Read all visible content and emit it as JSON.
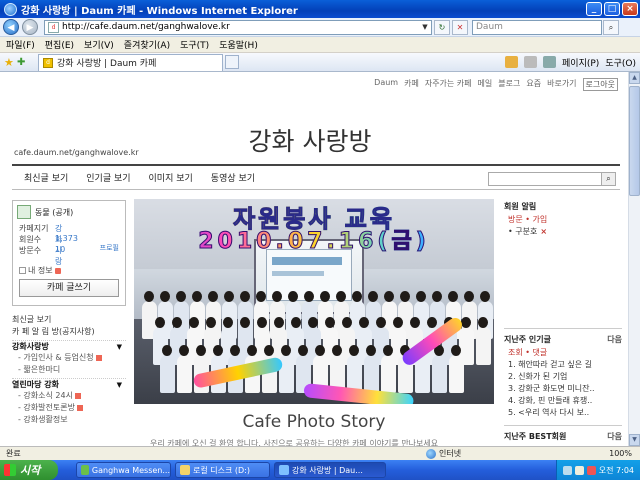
{
  "window": {
    "title": "강화 사랑방 | Daum 카페 - Windows Internet Explorer"
  },
  "address": {
    "url": "http://cafe.daum.net/ganghwalove.kr",
    "search_placeholder": "Daum"
  },
  "menu": {
    "items": [
      "파일(F)",
      "편집(E)",
      "보기(V)",
      "즐겨찾기(A)",
      "도구(T)",
      "도움말(H)"
    ]
  },
  "tabs": {
    "active": "강화 사랑방 | Daum 카페"
  },
  "commands": {
    "page": "페이지(P)",
    "tools": "도구(O)"
  },
  "page": {
    "topnav": [
      "Daum",
      "카페",
      "자주가는 카페",
      "메일",
      "블로그",
      "요즘",
      "바로가기"
    ],
    "logout": "로그아웃",
    "cafe_title": "강화 사랑방",
    "cafe_url": "cafe.daum.net/ganghwalove.kr",
    "tabs": [
      "최신글 보기",
      "인기글 보기",
      "이미지 보기",
      "동영상 보기"
    ],
    "profile": {
      "level": "동물 (공개)",
      "manager_label": "카페지기",
      "manager_value": "강화사랑",
      "members_label": "회원수",
      "members_value": "1,373",
      "visitors_label": "방문수",
      "visitors_value": "10",
      "profile_link": "프로필",
      "my_info": "내 정보",
      "write_button": "카페 글쓰기"
    },
    "left_menu": [
      {
        "text": "최신글 보기",
        "type": "item"
      },
      {
        "text": "카 페 알 림 방(공지사항)",
        "type": "item"
      },
      {
        "text": "강화사랑방",
        "type": "head"
      },
      {
        "text": "- 가입인사 & 등업신청",
        "type": "sub",
        "new": true
      },
      {
        "text": "- 짧은한마디",
        "type": "sub"
      },
      {
        "text": "열린마당 강화",
        "type": "head"
      },
      {
        "text": "- 강화소식 24시",
        "type": "sub",
        "new": true
      },
      {
        "text": "- 강화발전토론방",
        "type": "sub",
        "new": true
      },
      {
        "text": "- 강화생활정보",
        "type": "sub"
      }
    ],
    "photo_banner_line1": "자원봉사 교육",
    "photo_banner_line2": "2010.07.16(금)",
    "photo_caption": "Cafe Photo Story",
    "photo_sub": "우리 카페에 오신 걸 환영 합니다. 사진으로 공유하는 다양한 카페 이야기를 만나보세요",
    "right": {
      "member_alert_title": "회원 알림",
      "member_alert_items": [
        "방문 • 가입",
        "구분호"
      ],
      "popular_title": "지난주 인기글",
      "popular_more": "다음",
      "popular_tabs": "조회 • 댓글",
      "popular_items": [
        "1. 해안따라 걷고 싶은 길",
        "2. 신화가 된 기업",
        "3. 강화군 화도면 미니잔..",
        "4. 강화, 핀 만들래 휴쟁..",
        "5. <우리 역사 다시 보.."
      ],
      "best_title": "지난주 BEST회원",
      "best_more": "다음"
    }
  },
  "status": {
    "left": "완료",
    "zone": "인터넷",
    "zoom": "100%"
  },
  "taskbar": {
    "start": "시작",
    "buttons": [
      "Ganghwa Messen...",
      "로컬 디스크 (D:)",
      "강화 사랑방 | Dau..."
    ],
    "clock": "오전 7:04"
  }
}
